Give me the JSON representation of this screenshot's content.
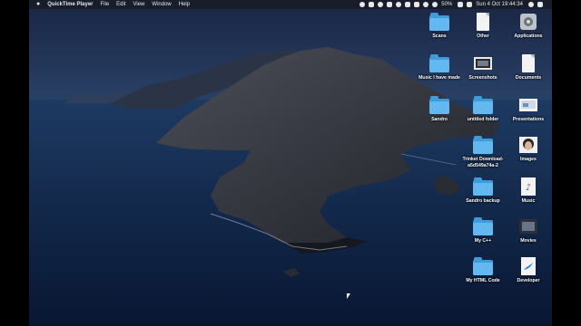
{
  "menubar": {
    "app_name": "QuickTime Player",
    "menus": [
      "File",
      "Edit",
      "View",
      "Window",
      "Help"
    ],
    "battery": "50%",
    "clock": "Sun 4 Oct  19:44:34"
  },
  "desktop_icons": [
    {
      "label": "Scans",
      "icon": "folder-icon"
    },
    {
      "label": "Other",
      "icon": "document-icon"
    },
    {
      "label": "Applications",
      "icon": "applications-drive-icon"
    },
    {
      "label": "Music I have made",
      "icon": "folder-icon"
    },
    {
      "label": "Screenshots",
      "icon": "screenshot-icon"
    },
    {
      "label": "Documents",
      "icon": "document-icon"
    },
    {
      "label": "Sandro",
      "icon": "folder-icon"
    },
    {
      "label": "untitled folder",
      "icon": "folder-icon"
    },
    {
      "label": "Presentations",
      "icon": "presentation-icon"
    },
    {
      "label": "Trinket Download-a5d549a74a-2",
      "icon": "folder-icon"
    },
    {
      "label": "Images",
      "icon": "images-icon"
    },
    {
      "label": "Sandro backup",
      "icon": "folder-icon"
    },
    {
      "label": "Music",
      "icon": "music-icon"
    },
    {
      "label": "My C++",
      "icon": "folder-icon"
    },
    {
      "label": "Movies",
      "icon": "movies-icon"
    },
    {
      "label": "My HTML Code",
      "icon": "folder-icon"
    },
    {
      "label": "Developer",
      "icon": "developer-icon"
    }
  ],
  "colors": {
    "folder": "#62b8ef",
    "menubar": "#181c28"
  }
}
